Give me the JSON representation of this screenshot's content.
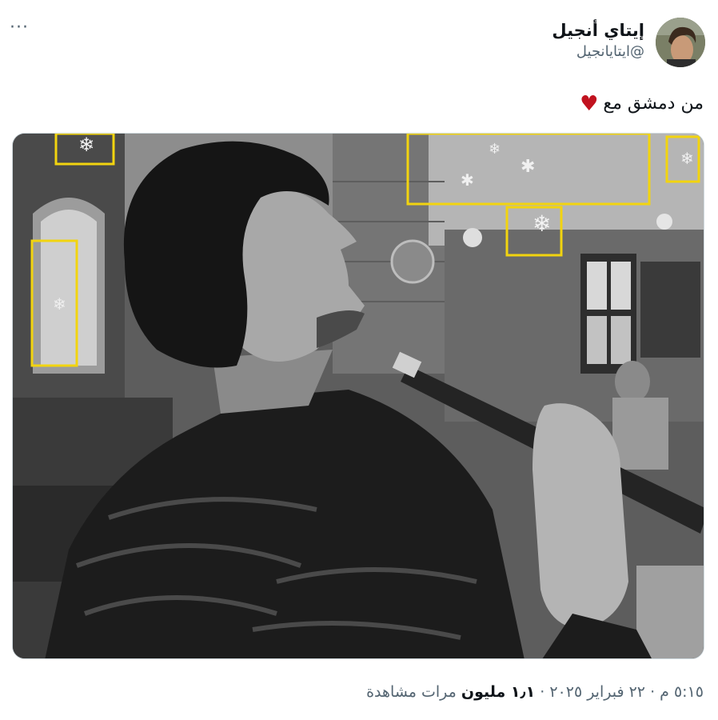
{
  "author": {
    "display_name": "إيتاي أنجيل",
    "handle": "@ايتايانجيل",
    "avatar_icon": "profile-photo"
  },
  "more_label": "···",
  "tweet": {
    "text": "من دمشق مع",
    "emoji": "♥"
  },
  "media": {
    "icon": "photo",
    "highlight_color": "#f2d40f"
  },
  "meta": {
    "time": "٥:١٥ م",
    "separator": "·",
    "date": "٢٢ فبراير ٢٠٢٥",
    "views_count": "١٫١ مليون",
    "views_label": "مرات مشاهدة"
  }
}
